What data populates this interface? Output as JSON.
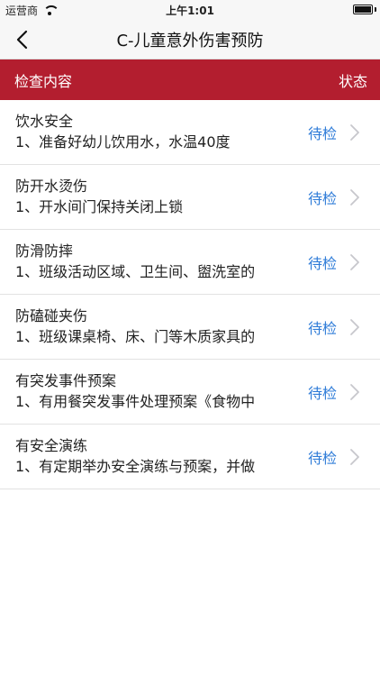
{
  "status_bar": {
    "carrier": "运营商",
    "time": "上午1:01"
  },
  "nav": {
    "title": "C-儿童意外伤害预防"
  },
  "table_header": {
    "content_label": "检查内容",
    "status_label": "状态"
  },
  "colors": {
    "header_red": "#b31e2f",
    "status_blue": "#2f7cd8"
  },
  "items": [
    {
      "title": "饮水安全",
      "desc": "1、准备好幼儿饮用水，水温40度",
      "status": "待检"
    },
    {
      "title": "防开水烫伤",
      "desc": "1、开水间门保持关闭上锁",
      "status": "待检"
    },
    {
      "title": "防滑防摔",
      "desc": "1、班级活动区域、卫生间、盥洗室的",
      "status": "待检"
    },
    {
      "title": "防磕碰夹伤",
      "desc": "1、班级课桌椅、床、门等木质家具的",
      "status": "待检"
    },
    {
      "title": "有突发事件预案",
      "desc": "1、有用餐突发事件处理预案《食物中",
      "status": "待检"
    },
    {
      "title": "有安全演练",
      "desc": "1、有定期举办安全演练与预案，并做",
      "status": "待检"
    }
  ]
}
